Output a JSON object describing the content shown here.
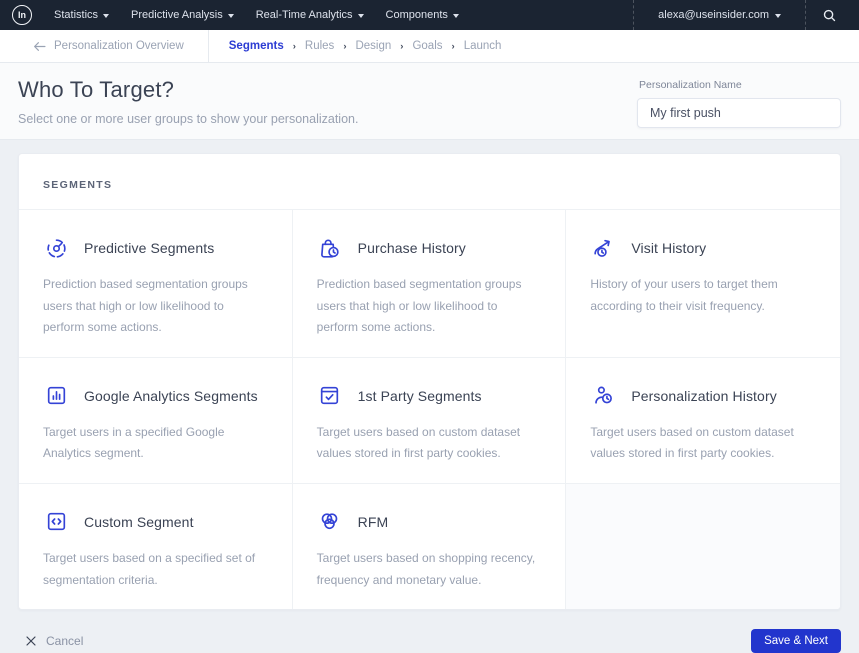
{
  "navbar": {
    "logo_text": "In",
    "items": [
      {
        "label": "Statistics"
      },
      {
        "label": "Predictive Analysis"
      },
      {
        "label": "Real-Time Analytics"
      },
      {
        "label": "Components"
      }
    ],
    "account_email": "alexa@useinsider.com"
  },
  "breadcrumb": {
    "back_label": "Personalization Overview",
    "steps": [
      {
        "label": "Segments",
        "active": true
      },
      {
        "label": "Rules",
        "active": false
      },
      {
        "label": "Design",
        "active": false
      },
      {
        "label": "Goals",
        "active": false
      },
      {
        "label": "Launch",
        "active": false
      }
    ]
  },
  "header": {
    "title": "Who To Target?",
    "subtitle": "Select one or more user groups to show your personalization.",
    "name_label": "Personalization Name",
    "name_value": "My first push"
  },
  "segments_panel": {
    "title": "SEGMENTS",
    "tiles": [
      {
        "icon": "predictive-segments-icon",
        "title": "Predictive Segments",
        "description": "Prediction based segmentation groups users that high or low likelihood to perform some actions."
      },
      {
        "icon": "purchase-history-icon",
        "title": "Purchase History",
        "description": "Prediction based segmentation groups users that high or low likelihood to perform some actions."
      },
      {
        "icon": "visit-history-icon",
        "title": "Visit History",
        "description": "History of your users to target them according to their visit frequency."
      },
      {
        "icon": "google-analytics-icon",
        "title": "Google Analytics Segments",
        "description": "Target users in a specified Google Analytics segment."
      },
      {
        "icon": "first-party-segments-icon",
        "title": "1st Party Segments",
        "description": "Target users based on custom dataset values stored in first party cookies."
      },
      {
        "icon": "personalization-history-icon",
        "title": "Personalization History",
        "description": "Target users based on custom dataset values stored in first party cookies."
      },
      {
        "icon": "custom-segment-icon",
        "title": "Custom Segment",
        "description": "Target users based on a specified set of segmentation criteria."
      },
      {
        "icon": "rfm-icon",
        "title": "RFM",
        "description": "Target users based on shopping recency, frequency and monetary value."
      }
    ]
  },
  "footer": {
    "cancel_label": "Cancel",
    "save_label": "Save & Next"
  },
  "colors": {
    "navbar_bg": "#1b2432",
    "accent_blue": "#2c3cd3",
    "icon_blue": "#3443d6",
    "button_blue": "#2235cd",
    "page_bg": "#edf0f4",
    "muted_text": "#99a1b1"
  }
}
